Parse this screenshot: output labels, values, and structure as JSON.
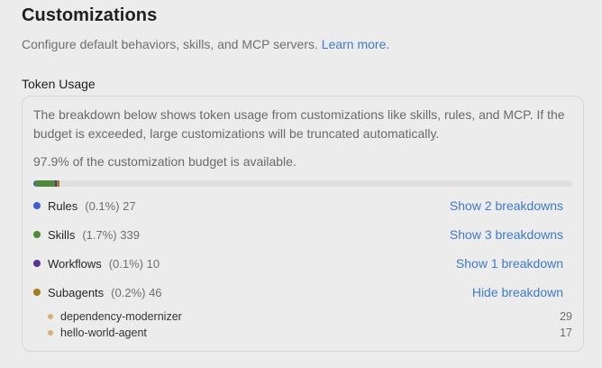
{
  "header": {
    "title": "Customizations",
    "subtitle": "Configure default behaviors, skills, and MCP servers.",
    "learn_more": "Learn more."
  },
  "token_usage": {
    "section_title": "Token Usage",
    "description": "The breakdown below shows token usage from customizations like skills, rules, and MCP. If the budget is exceeded, large customizations will be truncated automatically.",
    "budget_text": "97.9% of the customization budget is available.",
    "budget_available_percent": 97.9,
    "colors": {
      "rules": "#3b5fd1",
      "skills": "#4e8a3a",
      "workflows": "#5a3396",
      "subagents": "#a07e1f",
      "subagent_items": "#d4b26f",
      "bar_track": "#e0e0e0"
    },
    "categories": [
      {
        "name": "Rules",
        "percent_label": "(0.1%)",
        "tokens": "27",
        "percent": 0.1,
        "action": "Show 2 breakdowns",
        "color_key": "rules"
      },
      {
        "name": "Skills",
        "percent_label": "(1.7%)",
        "tokens": "339",
        "percent": 1.7,
        "action": "Show 3 breakdowns",
        "color_key": "skills"
      },
      {
        "name": "Workflows",
        "percent_label": "(0.1%)",
        "tokens": "10",
        "percent": 0.1,
        "action": "Show 1 breakdown",
        "color_key": "workflows"
      },
      {
        "name": "Subagents",
        "percent_label": "(0.2%)",
        "tokens": "46",
        "percent": 0.2,
        "action": "Hide breakdown",
        "color_key": "subagents"
      }
    ],
    "subagent_breakdown": [
      {
        "name": "dependency-modernizer",
        "tokens": "29"
      },
      {
        "name": "hello-world-agent",
        "tokens": "17"
      }
    ]
  }
}
